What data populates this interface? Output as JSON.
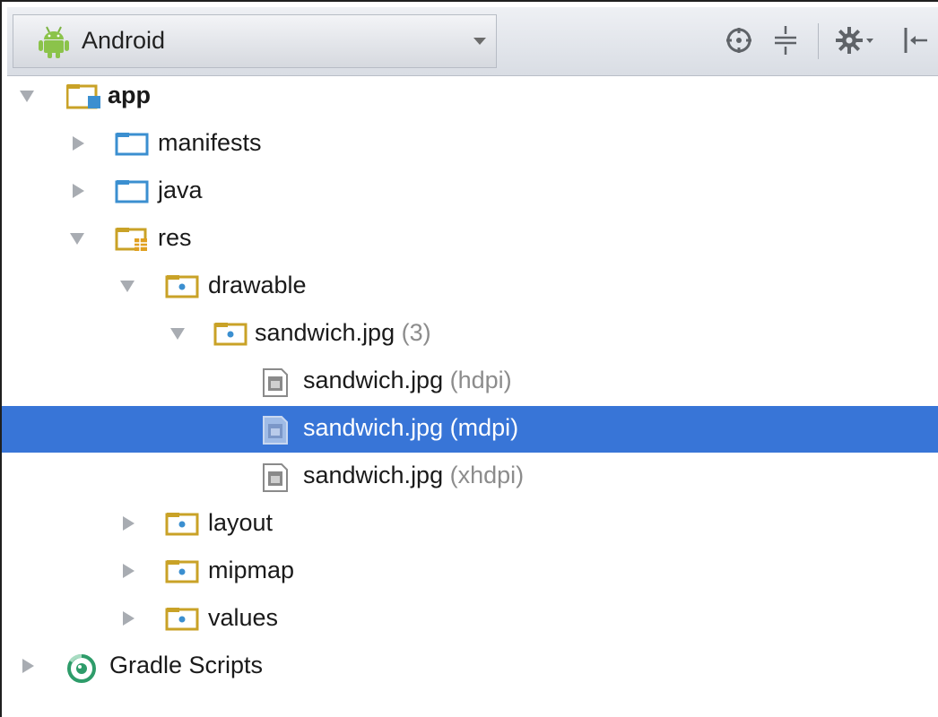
{
  "toolbar": {
    "view_selector": {
      "label": "Android",
      "icon": "android-icon"
    },
    "buttons": [
      {
        "name": "scroll-from-source-button",
        "icon": "crosshair-icon"
      },
      {
        "name": "collapse-all-button",
        "icon": "collapse-all-icon"
      },
      {
        "name": "settings-button",
        "icon": "gear-icon"
      },
      {
        "name": "hide-panel-button",
        "icon": "hide-icon"
      }
    ]
  },
  "tree": {
    "app": {
      "label": "app"
    },
    "manifests": {
      "label": "manifests"
    },
    "java": {
      "label": "java"
    },
    "res": {
      "label": "res"
    },
    "drawable": {
      "label": "drawable"
    },
    "sandwich_group": {
      "label": "sandwich.jpg",
      "note": "(3)"
    },
    "sandwich_hdpi": {
      "label": "sandwich.jpg",
      "note": "(hdpi)"
    },
    "sandwich_mdpi": {
      "label": "sandwich.jpg",
      "note": "(mdpi)"
    },
    "sandwich_xhdpi": {
      "label": "sandwich.jpg",
      "note": "(xhdpi)"
    },
    "layout": {
      "label": "layout"
    },
    "mipmap": {
      "label": "mipmap"
    },
    "values": {
      "label": "values"
    },
    "gradle_scripts": {
      "label": "Gradle Scripts"
    }
  },
  "colors": {
    "selection": "#3875d7",
    "folder": "#3b8fd0",
    "res_folder": "#c9a227",
    "gradle": "#2e9c6a"
  }
}
